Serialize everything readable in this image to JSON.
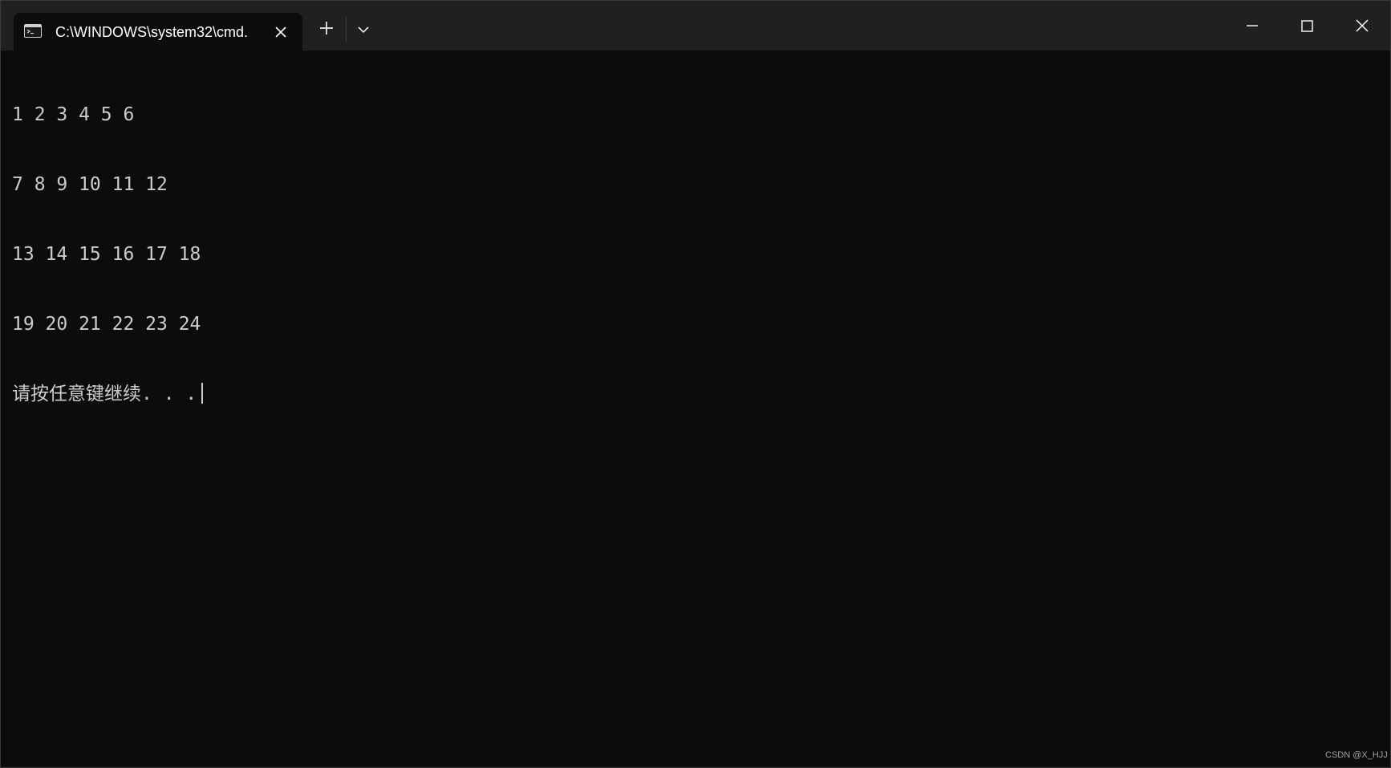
{
  "window": {
    "tab_title": "C:\\WINDOWS\\system32\\cmd.",
    "tab_icon": "terminal-icon",
    "buttons": {
      "new_tab": "plus-icon",
      "dropdown": "chevron-down-icon",
      "minimize": "minimize-icon",
      "maximize": "maximize-icon",
      "close": "close-icon"
    }
  },
  "terminal": {
    "lines": [
      "1 2 3 4 5 6",
      "7 8 9 10 11 12",
      "13 14 15 16 17 18",
      "19 20 21 22 23 24",
      "请按任意键继续. . ."
    ]
  },
  "watermark": "CSDN @X_HJJ",
  "colors": {
    "background": "#0c0c0c",
    "titlebar": "#202020",
    "text": "#cccccc"
  }
}
